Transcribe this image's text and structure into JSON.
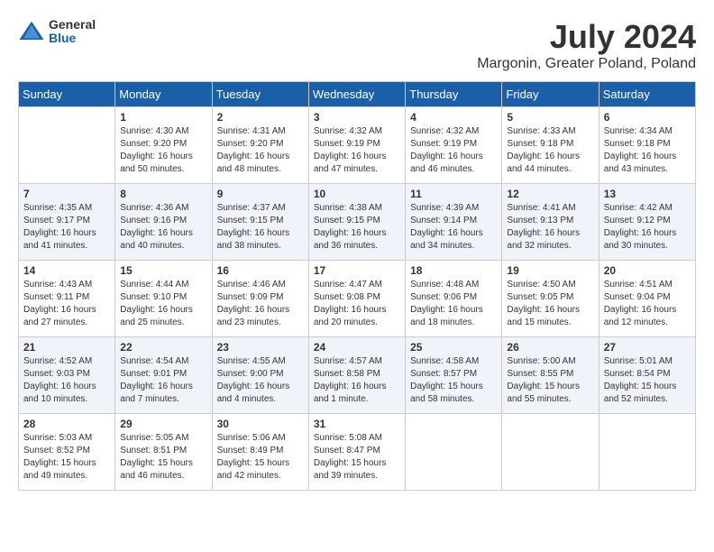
{
  "header": {
    "logo": {
      "line1": "General",
      "line2": "Blue"
    },
    "title": "July 2024",
    "location": "Margonin, Greater Poland, Poland"
  },
  "days_of_week": [
    "Sunday",
    "Monday",
    "Tuesday",
    "Wednesday",
    "Thursday",
    "Friday",
    "Saturday"
  ],
  "weeks": [
    [
      {
        "day": "",
        "content": ""
      },
      {
        "day": "1",
        "content": "Sunrise: 4:30 AM\nSunset: 9:20 PM\nDaylight: 16 hours\nand 50 minutes."
      },
      {
        "day": "2",
        "content": "Sunrise: 4:31 AM\nSunset: 9:20 PM\nDaylight: 16 hours\nand 48 minutes."
      },
      {
        "day": "3",
        "content": "Sunrise: 4:32 AM\nSunset: 9:19 PM\nDaylight: 16 hours\nand 47 minutes."
      },
      {
        "day": "4",
        "content": "Sunrise: 4:32 AM\nSunset: 9:19 PM\nDaylight: 16 hours\nand 46 minutes."
      },
      {
        "day": "5",
        "content": "Sunrise: 4:33 AM\nSunset: 9:18 PM\nDaylight: 16 hours\nand 44 minutes."
      },
      {
        "day": "6",
        "content": "Sunrise: 4:34 AM\nSunset: 9:18 PM\nDaylight: 16 hours\nand 43 minutes."
      }
    ],
    [
      {
        "day": "7",
        "content": "Sunrise: 4:35 AM\nSunset: 9:17 PM\nDaylight: 16 hours\nand 41 minutes."
      },
      {
        "day": "8",
        "content": "Sunrise: 4:36 AM\nSunset: 9:16 PM\nDaylight: 16 hours\nand 40 minutes."
      },
      {
        "day": "9",
        "content": "Sunrise: 4:37 AM\nSunset: 9:15 PM\nDaylight: 16 hours\nand 38 minutes."
      },
      {
        "day": "10",
        "content": "Sunrise: 4:38 AM\nSunset: 9:15 PM\nDaylight: 16 hours\nand 36 minutes."
      },
      {
        "day": "11",
        "content": "Sunrise: 4:39 AM\nSunset: 9:14 PM\nDaylight: 16 hours\nand 34 minutes."
      },
      {
        "day": "12",
        "content": "Sunrise: 4:41 AM\nSunset: 9:13 PM\nDaylight: 16 hours\nand 32 minutes."
      },
      {
        "day": "13",
        "content": "Sunrise: 4:42 AM\nSunset: 9:12 PM\nDaylight: 16 hours\nand 30 minutes."
      }
    ],
    [
      {
        "day": "14",
        "content": "Sunrise: 4:43 AM\nSunset: 9:11 PM\nDaylight: 16 hours\nand 27 minutes."
      },
      {
        "day": "15",
        "content": "Sunrise: 4:44 AM\nSunset: 9:10 PM\nDaylight: 16 hours\nand 25 minutes."
      },
      {
        "day": "16",
        "content": "Sunrise: 4:46 AM\nSunset: 9:09 PM\nDaylight: 16 hours\nand 23 minutes."
      },
      {
        "day": "17",
        "content": "Sunrise: 4:47 AM\nSunset: 9:08 PM\nDaylight: 16 hours\nand 20 minutes."
      },
      {
        "day": "18",
        "content": "Sunrise: 4:48 AM\nSunset: 9:06 PM\nDaylight: 16 hours\nand 18 minutes."
      },
      {
        "day": "19",
        "content": "Sunrise: 4:50 AM\nSunset: 9:05 PM\nDaylight: 16 hours\nand 15 minutes."
      },
      {
        "day": "20",
        "content": "Sunrise: 4:51 AM\nSunset: 9:04 PM\nDaylight: 16 hours\nand 12 minutes."
      }
    ],
    [
      {
        "day": "21",
        "content": "Sunrise: 4:52 AM\nSunset: 9:03 PM\nDaylight: 16 hours\nand 10 minutes."
      },
      {
        "day": "22",
        "content": "Sunrise: 4:54 AM\nSunset: 9:01 PM\nDaylight: 16 hours\nand 7 minutes."
      },
      {
        "day": "23",
        "content": "Sunrise: 4:55 AM\nSunset: 9:00 PM\nDaylight: 16 hours\nand 4 minutes."
      },
      {
        "day": "24",
        "content": "Sunrise: 4:57 AM\nSunset: 8:58 PM\nDaylight: 16 hours\nand 1 minute."
      },
      {
        "day": "25",
        "content": "Sunrise: 4:58 AM\nSunset: 8:57 PM\nDaylight: 15 hours\nand 58 minutes."
      },
      {
        "day": "26",
        "content": "Sunrise: 5:00 AM\nSunset: 8:55 PM\nDaylight: 15 hours\nand 55 minutes."
      },
      {
        "day": "27",
        "content": "Sunrise: 5:01 AM\nSunset: 8:54 PM\nDaylight: 15 hours\nand 52 minutes."
      }
    ],
    [
      {
        "day": "28",
        "content": "Sunrise: 5:03 AM\nSunset: 8:52 PM\nDaylight: 15 hours\nand 49 minutes."
      },
      {
        "day": "29",
        "content": "Sunrise: 5:05 AM\nSunset: 8:51 PM\nDaylight: 15 hours\nand 46 minutes."
      },
      {
        "day": "30",
        "content": "Sunrise: 5:06 AM\nSunset: 8:49 PM\nDaylight: 15 hours\nand 42 minutes."
      },
      {
        "day": "31",
        "content": "Sunrise: 5:08 AM\nSunset: 8:47 PM\nDaylight: 15 hours\nand 39 minutes."
      },
      {
        "day": "",
        "content": ""
      },
      {
        "day": "",
        "content": ""
      },
      {
        "day": "",
        "content": ""
      }
    ]
  ]
}
